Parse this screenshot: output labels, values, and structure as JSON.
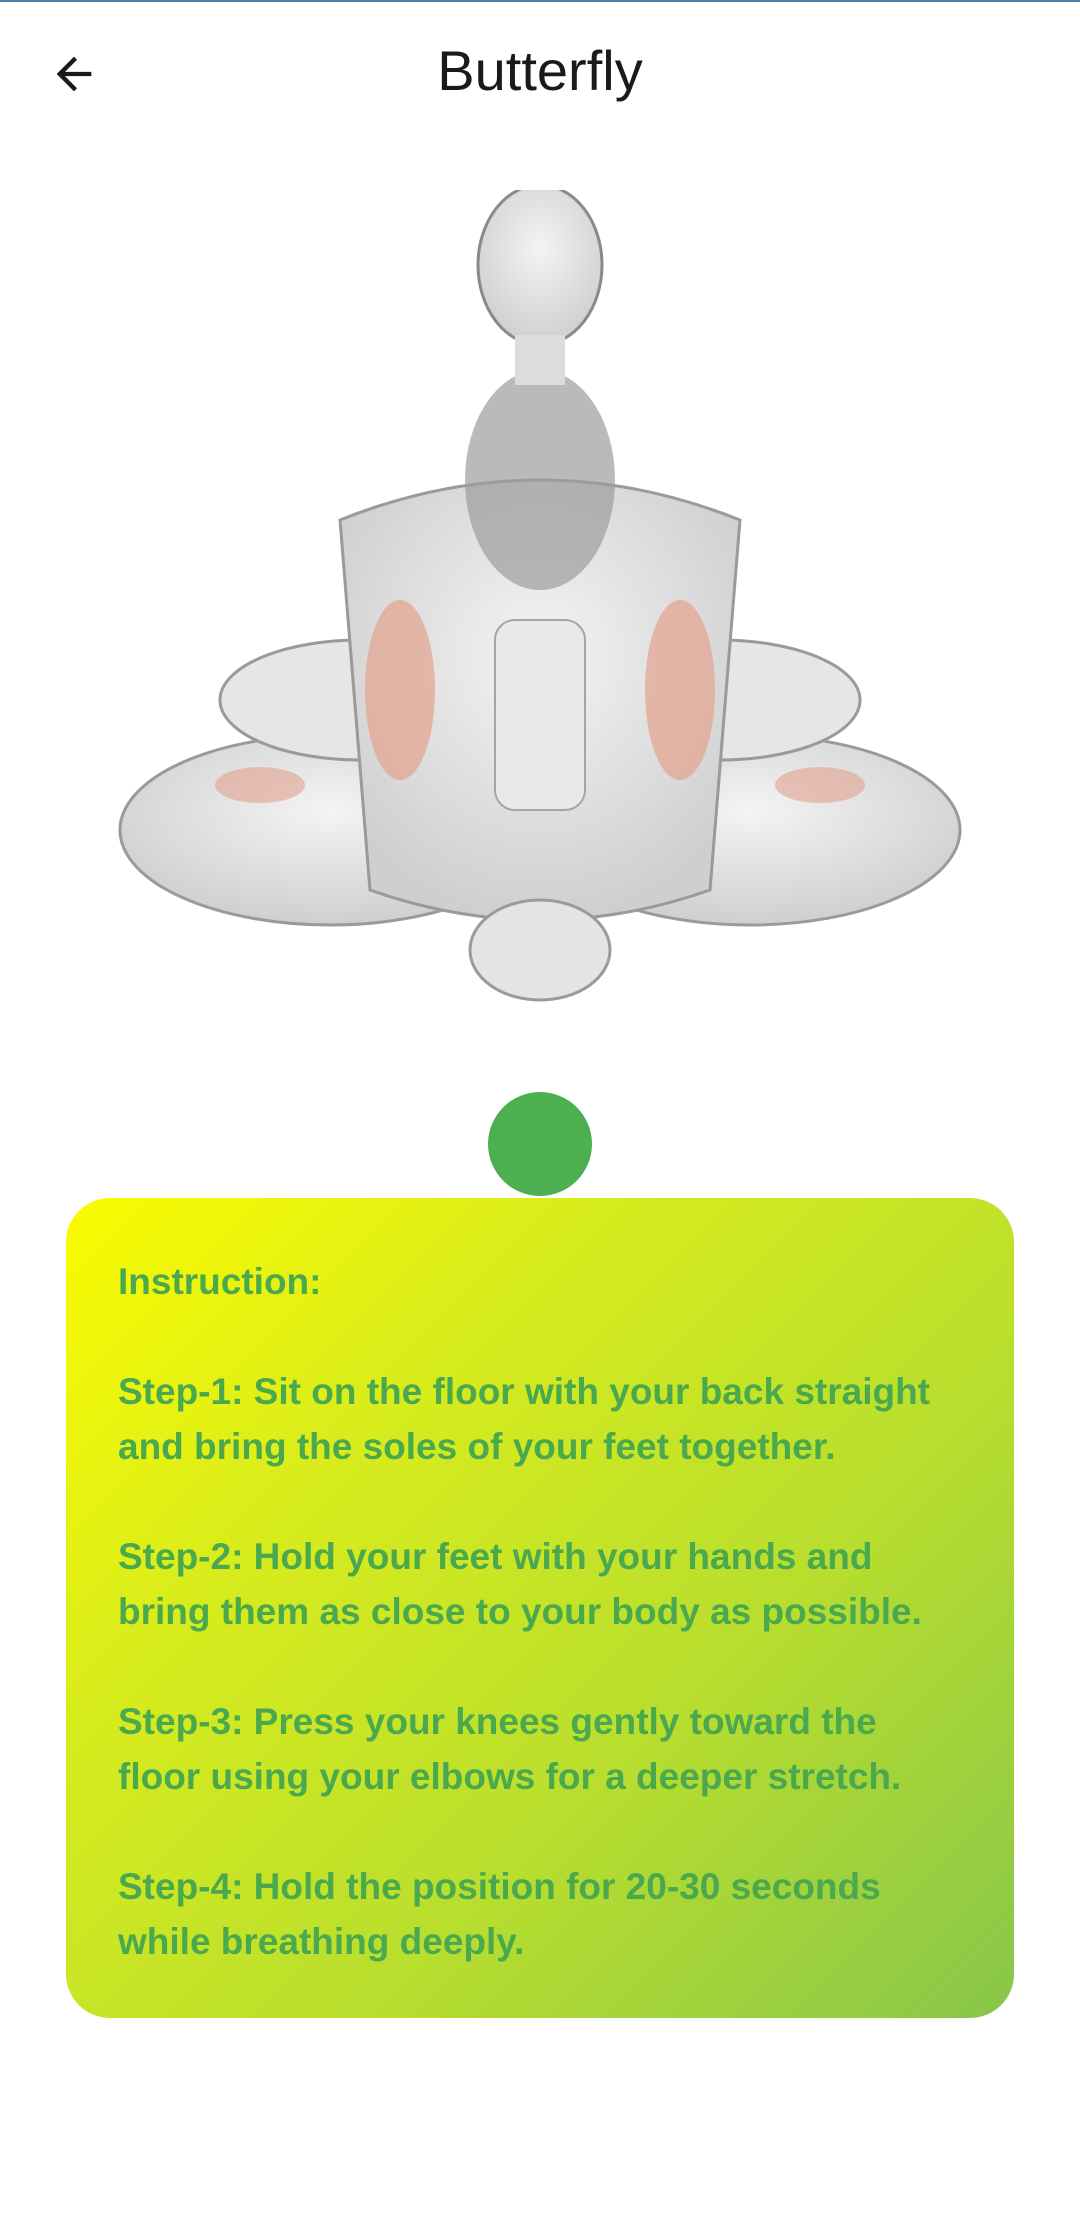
{
  "header": {
    "title": "Butterfly",
    "back_icon": "arrow-left-icon"
  },
  "illustration": {
    "subject": "butterfly-stretch-figure"
  },
  "indicator": {
    "color": "#4caf50"
  },
  "instructions": {
    "heading": "Instruction:",
    "steps": [
      "Step-1: Sit on the floor with your back straight and bring the soles of your feet together.",
      "Step-2: Hold your feet with your hands and bring them as close to your body as possible.",
      "Step-3: Press your knees gently toward the floor using your elbows for a deeper stretch.",
      "Step-4: Hold the position for 20-30 seconds while breathing deeply."
    ]
  },
  "colors": {
    "card_gradient_start": "#fbfb00",
    "card_gradient_end": "#88c64a",
    "text": "#4aa84e"
  }
}
